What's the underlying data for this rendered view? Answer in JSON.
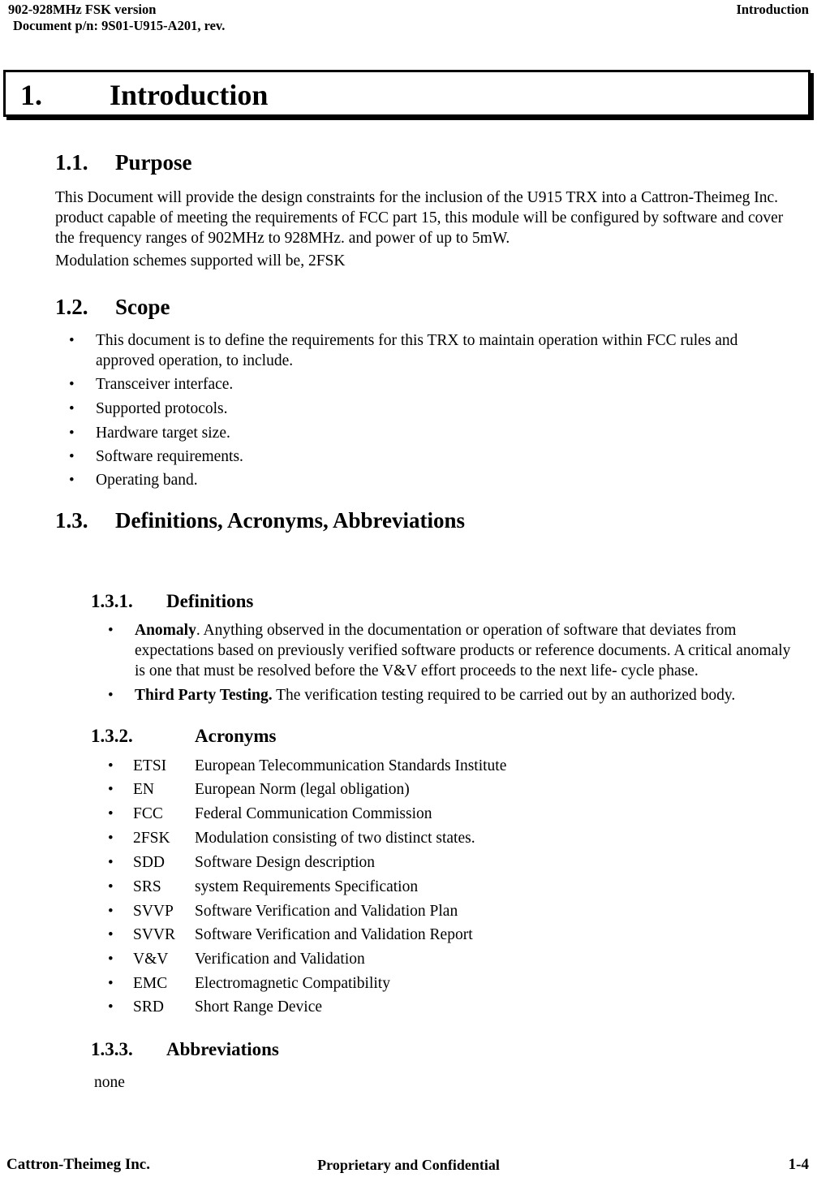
{
  "header": {
    "left_line1": "902-928MHz FSK version",
    "left_line2": "Document p/n: 9S01-U915-A201, rev.",
    "right": "Introduction"
  },
  "chapter": {
    "number": "1.",
    "title": "Introduction"
  },
  "sections": {
    "purpose": {
      "number": "1.1.",
      "title": "Purpose",
      "paragraph1": "This Document will provide the design constraints for the inclusion of the U915 TRX into a Cattron-Theimeg Inc. product capable of meeting the requirements of  FCC part 15, this module will be configured by software and cover the frequency ranges of 902MHz to 928MHz. and power of up to 5mW.",
      "paragraph2": "Modulation schemes supported will be, 2FSK"
    },
    "scope": {
      "number": "1.2.",
      "title": "Scope",
      "bullets": [
        "This document is to define the requirements for this TRX to maintain operation within FCC rules and approved operation, to include.",
        "Transceiver interface.",
        "Supported protocols.",
        "Hardware target size.",
        "Software requirements.",
        "Operating band."
      ]
    },
    "definitions_acronyms": {
      "number": "1.3.",
      "title": "Definitions, Acronyms, Abbreviations"
    },
    "definitions": {
      "number": "1.3.1.",
      "title": "Definitions",
      "items": [
        {
          "term": "Anomaly",
          "term_tail": ".",
          "text": "  Anything observed in the documentation or operation of software that deviates from expectations based on previously verified software products or reference documents.  A critical anomaly is one that must be resolved before the V&V effort proceeds to the next life- cycle phase."
        },
        {
          "term": "Third Party Testing.",
          "term_tail": "",
          "text": " The verification testing required to be carried out by an authorized body."
        }
      ]
    },
    "acronyms": {
      "number": "1.3.2.",
      "title": "Acronyms",
      "items": [
        {
          "abbr": "ETSI",
          "expansion": "European Telecommunication Standards Institute"
        },
        {
          "abbr": "EN",
          "expansion": "European Norm (legal obligation)"
        },
        {
          "abbr": "FCC",
          "expansion": "Federal Communication Commission"
        },
        {
          "abbr": "2FSK",
          "expansion": "Modulation consisting of  two distinct states."
        },
        {
          "abbr": "SDD",
          "expansion": "Software Design description"
        },
        {
          "abbr": "SRS",
          "expansion": "system Requirements Specification"
        },
        {
          "abbr": "SVVP",
          "expansion": "Software Verification and Validation Plan"
        },
        {
          "abbr": "SVVR",
          "expansion": "Software Verification and Validation Report"
        },
        {
          "abbr": "V&V",
          "expansion": "Verification and Validation"
        },
        {
          "abbr": "EMC",
          "expansion": "Electromagnetic Compatibility"
        },
        {
          "abbr": "SRD",
          "expansion": "Short Range Device"
        }
      ]
    },
    "abbreviations": {
      "number": "1.3.3.",
      "title": "Abbreviations",
      "content": "none"
    }
  },
  "bullet_glyph": "•",
  "footer": {
    "left": "Cattron-Theimeg Inc.",
    "center": "Proprietary and Confidential",
    "right": "1-4"
  }
}
